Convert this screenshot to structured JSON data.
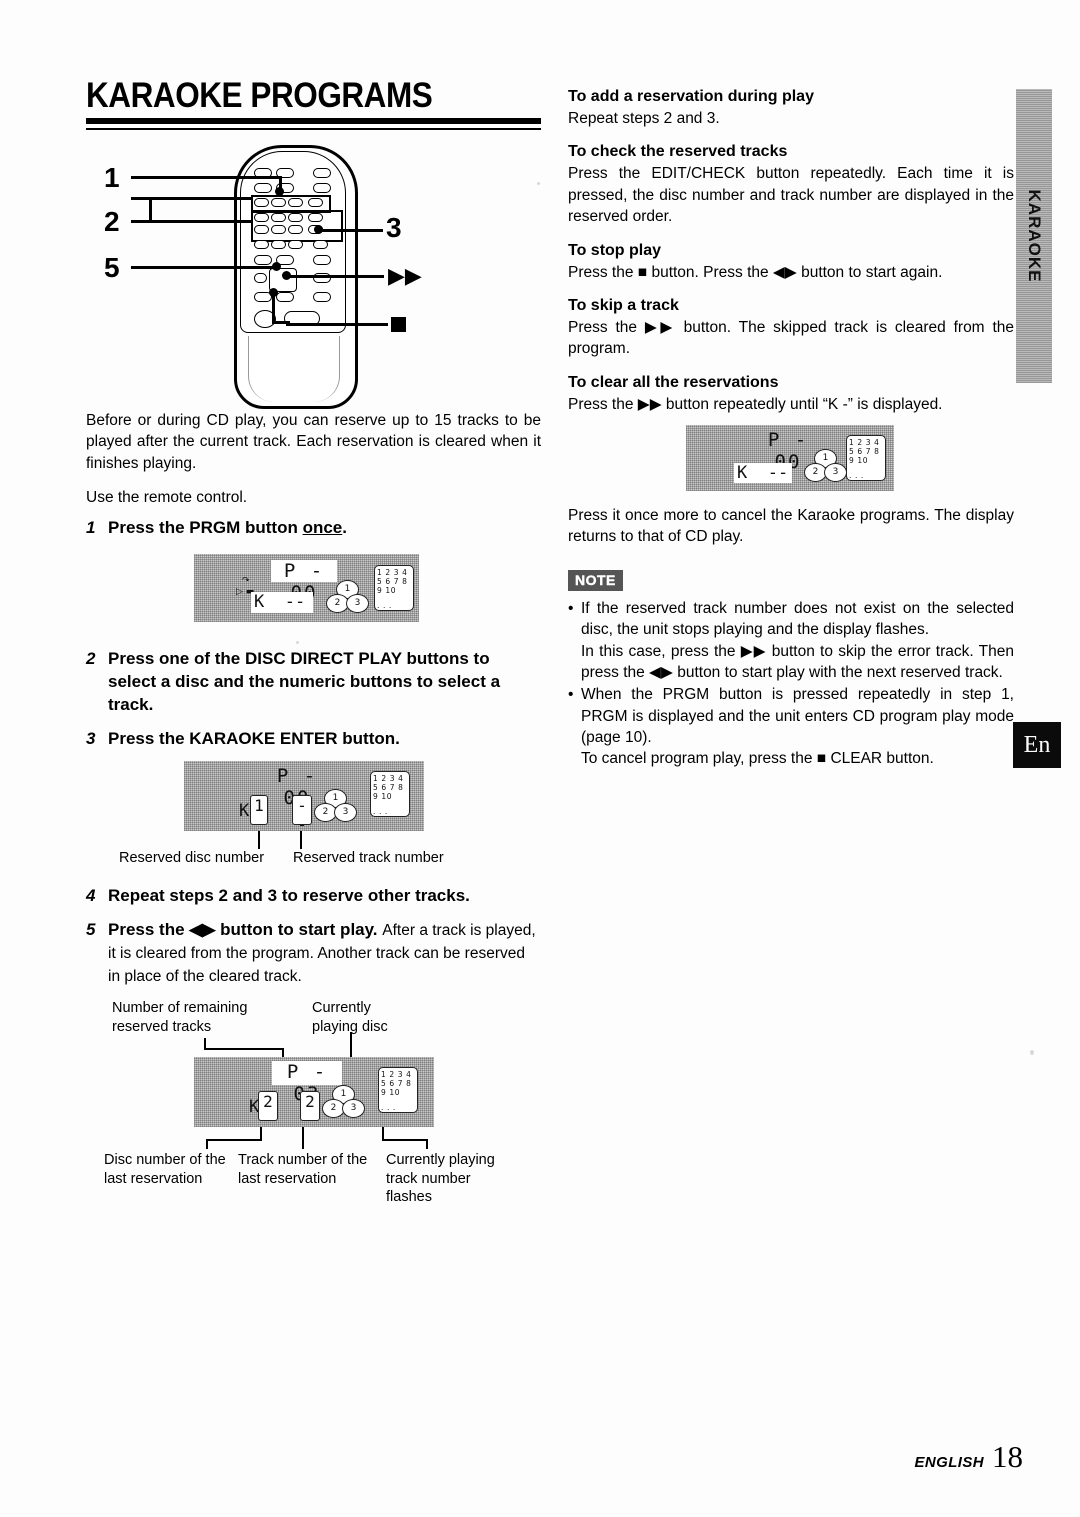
{
  "document": {
    "title": "KARAOKE PROGRAMS",
    "side_tab_label": "KARAOKE",
    "language_badge": "En",
    "footer_language": "ENGLISH",
    "footer_page": "18"
  },
  "remote_figure": {
    "callouts": [
      "1",
      "2",
      "3",
      "5"
    ],
    "symbol_skip": "▶▶",
    "symbol_stop": "■"
  },
  "left_column": {
    "intro": "Before or during CD play, you can reserve up to 15 tracks to be played after the current track.  Each reservation is cleared when it finishes playing.",
    "use_remote": "Use the remote control.",
    "steps": [
      {
        "num": "1",
        "text_before": "Press the PRGM button ",
        "text_underlined": "once",
        "text_after": "."
      },
      {
        "num": "2",
        "text": "Press one of the DISC DIRECT PLAY buttons to select a disc and the numeric buttons to select a track."
      },
      {
        "num": "3",
        "text": "Press the KARAOKE ENTER button."
      },
      {
        "num": "4",
        "text": "Repeat steps 2 and 3 to reserve other tracks."
      },
      {
        "num": "5",
        "text": "Press the ◀▶ button to start play.",
        "sub": "After a track is played, it is cleared from the program.  Another track can be reserved in place of the cleared track."
      }
    ],
    "display_step1": {
      "main": "P - 00",
      "karaoke_line": "K  --",
      "discs": [
        "1",
        "2",
        "3"
      ],
      "tracks_rows": [
        "1 2 3 4",
        "5 6 7 8",
        "9 10",
        ". . ."
      ]
    },
    "display_step3": {
      "main": "P - 00",
      "karaoke_prefix": "K",
      "disc_box": "1",
      "track_box": "--",
      "discs": [
        "1",
        "2",
        "3"
      ],
      "tracks_rows": [
        "1 2 3 4",
        "5 6 7 8",
        "9 10",
        ". . ."
      ],
      "caption_disc": "Reserved disc number",
      "caption_track": "Reserved track number"
    },
    "display_play": {
      "main": "P - 03",
      "karaoke_prefix": "K",
      "disc_box": "2",
      "track_box": "2",
      "discs": [
        "1",
        "2",
        "3"
      ],
      "tracks_rows": [
        "1 2 3 4",
        "5 6 7 8",
        "9 10",
        ". . ."
      ],
      "caption_top_left": "Number of remaining reserved tracks",
      "caption_top_right": "Currently playing disc",
      "caption_bottom_left": "Disc number of the last reservation",
      "caption_bottom_mid": "Track number of the last reservation",
      "caption_bottom_right": "Currently playing track number flashes"
    }
  },
  "right_column": {
    "sections": [
      {
        "heading": "To add a reservation during play",
        "body": "Repeat steps 2 and 3."
      },
      {
        "heading": "To check the reserved tracks",
        "body": "Press the EDIT/CHECK button repeatedly.  Each time it is pressed, the disc number and track number are displayed in the reserved order."
      },
      {
        "heading": "To stop play",
        "body": "Press the ■ button.  Press the ◀▶ button to start again."
      },
      {
        "heading": "To skip a track",
        "body": "Press the ▶▶ button.  The skipped track is cleared from the program."
      },
      {
        "heading": "To clear all the reservations",
        "body": "Press the ▶▶ button repeatedly until “K -” is displayed."
      }
    ],
    "display_clear": {
      "main": "P - 00",
      "karaoke_line": "K  --",
      "discs": [
        "1",
        "2",
        "3"
      ],
      "tracks_rows": [
        "1 2 3 4",
        "5 6 7 8",
        "9 10",
        ". . ."
      ]
    },
    "after_display": "Press it once more to cancel the Karaoke programs. The display returns to that of CD play.",
    "note": {
      "badge": "NOTE",
      "items": [
        {
          "text": "If the reserved track number does not exist on the selected disc, the unit stops playing and the display flashes.",
          "sub": "In this case, press the ▶▶ button to skip the error track. Then press the ◀▶ button to start play with the next reserved track."
        },
        {
          "text": "When the PRGM button is pressed repeatedly in step 1, PRGM is displayed and the unit enters CD program play mode (page 10).",
          "sub": "To cancel program play, press the ■ CLEAR button."
        }
      ]
    }
  }
}
